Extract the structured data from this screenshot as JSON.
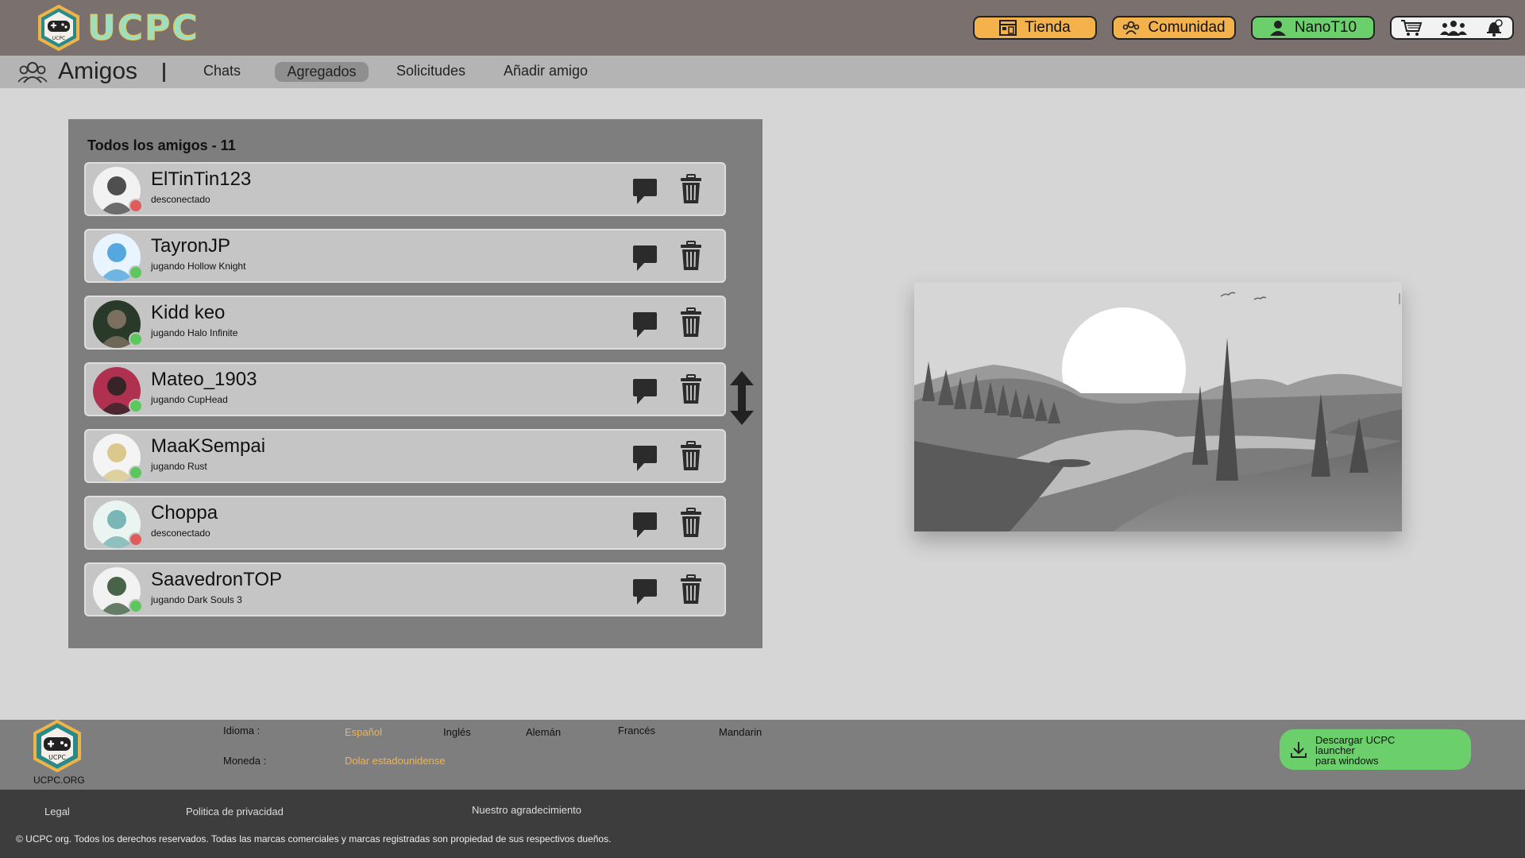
{
  "app": {
    "logo_text": "UCPC",
    "logo_small": "UCPC"
  },
  "header": {
    "store_label": "Tienda",
    "community_label": "Comunidad",
    "user_label": "NanoT10",
    "icons": [
      "cart-icon",
      "friends-icon",
      "notification-icon"
    ]
  },
  "subnav": {
    "title": "Amigos",
    "tabs": [
      {
        "label": "Chats",
        "active": false
      },
      {
        "label": "Agregados",
        "active": true
      },
      {
        "label": "Solicitudes",
        "active": false
      },
      {
        "label": "Añadir amigo",
        "active": false
      }
    ]
  },
  "friends": {
    "title": "Todos los amigos - 11",
    "list": [
      {
        "name": "ElTinTin123",
        "status": "desconectado",
        "online": false
      },
      {
        "name": "TayronJP",
        "status": "jugando Hollow Knight",
        "online": true
      },
      {
        "name": "Kidd keo",
        "status": "jugando Halo Infinite",
        "online": true
      },
      {
        "name": "Mateo_1903",
        "status": "jugando CupHead",
        "online": true
      },
      {
        "name": "MaaKSempai",
        "status": "jugando Rust",
        "online": true
      },
      {
        "name": "Choppa",
        "status": "desconectado",
        "online": false
      },
      {
        "name": "SaavedronTOP",
        "status": "jugando Dark Souls 3",
        "online": true
      }
    ]
  },
  "footer": {
    "brand": "UCPC.ORG",
    "language_label": "Idioma :",
    "languages": [
      {
        "label": "Español",
        "active": true
      },
      {
        "label": "Inglés",
        "active": false
      },
      {
        "label": "Alemán",
        "active": false
      },
      {
        "label": "Francés",
        "active": false
      },
      {
        "label": "Mandarin",
        "active": false
      }
    ],
    "currency_label": "Moneda :",
    "currency_value": "Dolar estadounidense",
    "download_line1": "Descargar UCPC",
    "download_line2": "launcher",
    "download_line3": "para windows"
  },
  "bottom": {
    "legal": "Legal",
    "privacy": "Politica de privacidad",
    "thanks": "Nuestro agradecimiento",
    "copyright": "© UCPC org. Todos los derechos reservados. Todas las marcas comerciales y marcas registradas son propiedad de sus respectivos dueños."
  },
  "colors": {
    "topbar": "#7a716f",
    "accent_orange": "#f4b24c",
    "accent_green": "#6bd06b",
    "status_offline": "#e05c5c",
    "status_online": "#5cc75c"
  }
}
